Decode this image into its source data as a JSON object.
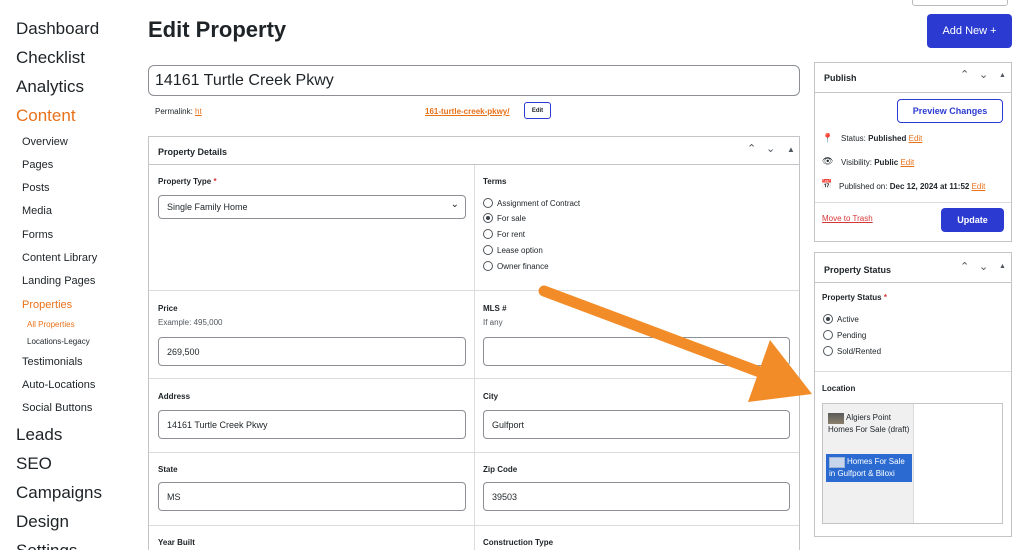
{
  "sidebar": {
    "top_items": [
      {
        "label": "Dashboard"
      },
      {
        "label": "Checklist"
      },
      {
        "label": "Analytics"
      },
      {
        "label": "Content"
      },
      {
        "label": "Leads"
      },
      {
        "label": "SEO"
      },
      {
        "label": "Campaigns"
      },
      {
        "label": "Design"
      },
      {
        "label": "Settings"
      }
    ],
    "content_items": [
      {
        "label": "Overview"
      },
      {
        "label": "Pages"
      },
      {
        "label": "Posts"
      },
      {
        "label": "Media"
      },
      {
        "label": "Forms"
      },
      {
        "label": "Content Library"
      },
      {
        "label": "Landing Pages"
      },
      {
        "label": "Properties"
      },
      {
        "label": "Testimonials"
      },
      {
        "label": "Auto-Locations"
      },
      {
        "label": "Social Buttons"
      }
    ],
    "properties_items": [
      {
        "label": "All Properties"
      },
      {
        "label": "Locations-Legacy"
      }
    ]
  },
  "header": {
    "title": "Edit Property",
    "add_new_label": "Add New +"
  },
  "post": {
    "title_value": "14161 Turtle Creek Pkwy",
    "permalink_label": "Permalink:",
    "permalink_start": "ht",
    "permalink_slug": "161-turtle-creek-pkwy/",
    "permalink_edit": "Edit"
  },
  "details": {
    "title": "Property Details",
    "property_type_label": "Property Type",
    "property_type_value": "Single Family Home",
    "terms_label": "Terms",
    "terms_options": [
      {
        "label": "Assignment of Contract",
        "checked": false
      },
      {
        "label": "For sale",
        "checked": true
      },
      {
        "label": "For rent",
        "checked": false
      },
      {
        "label": "Lease option",
        "checked": false
      },
      {
        "label": "Owner finance",
        "checked": false
      }
    ],
    "price_label": "Price",
    "price_hint": "Example: 495,000",
    "price_value": "269,500",
    "mls_label": "MLS #",
    "mls_hint": "If any",
    "mls_value": "",
    "address_label": "Address",
    "address_value": "14161 Turtle Creek Pkwy",
    "city_label": "City",
    "city_value": "Gulfport",
    "state_label": "State",
    "state_value": "MS",
    "zip_label": "Zip Code",
    "zip_value": "39503",
    "year_label": "Year Built",
    "construction_label": "Construction Type"
  },
  "publish": {
    "title": "Publish",
    "preview_label": "Preview Changes",
    "status_label": "Status:",
    "status_value": "Published",
    "visibility_label": "Visibility:",
    "visibility_value": "Public",
    "published_label": "Published on:",
    "published_value": "Dec 12, 2024 at 11:52",
    "edit_label": "Edit",
    "trash_label": "Move to Trash",
    "update_label": "Update"
  },
  "status_box": {
    "title": "Property Status",
    "field_label": "Property Status",
    "options": [
      {
        "label": "Active",
        "checked": true
      },
      {
        "label": "Pending",
        "checked": false
      },
      {
        "label": "Sold/Rented",
        "checked": false
      }
    ],
    "location_label": "Location",
    "locations": [
      {
        "label": "Algiers Point Homes For Sale (draft)",
        "selected": false
      },
      {
        "label": "Homes For Sale in Gulfport & Biloxi",
        "selected": true
      }
    ]
  },
  "colors": {
    "accent": "#2b3bd1",
    "orange": "#e8711a",
    "arrow": "#f28c28"
  },
  "icons": {
    "pin": "pin-icon",
    "eye": "eye-icon",
    "calendar": "calendar-icon"
  }
}
